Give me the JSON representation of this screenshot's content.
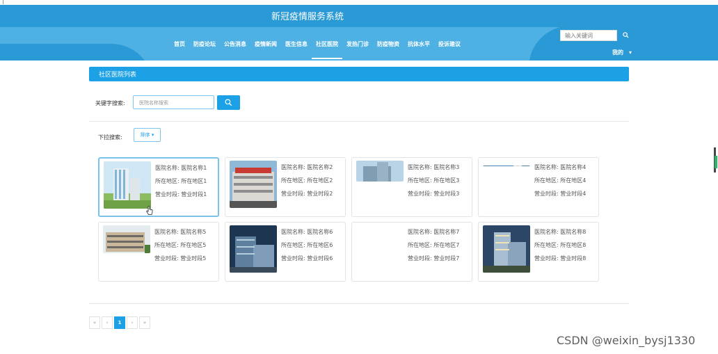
{
  "header": {
    "site_title": "新冠疫情服务系统",
    "nav": [
      {
        "label": "首页"
      },
      {
        "label": "防疫论坛"
      },
      {
        "label": "公告消息"
      },
      {
        "label": "疫情新闻"
      },
      {
        "label": "医生信息"
      },
      {
        "label": "社区医院",
        "active": true
      },
      {
        "label": "发热门诊"
      },
      {
        "label": "防疫物资"
      },
      {
        "label": "抗体水平"
      },
      {
        "label": "投诉建议"
      }
    ],
    "search_placeholder": "输入关键词",
    "user_label": "我的",
    "colors": {
      "primary": "#2a9ad6",
      "band": "#4fb1e3"
    }
  },
  "list": {
    "title": "社区医院列表",
    "keyword_label": "关键字搜索:",
    "keyword_placeholder": "医院名称搜索",
    "dropdown_label": "下拉搜索:",
    "sort_label": "排序",
    "field_labels": {
      "name": "医院名称:",
      "region": "所在地区:",
      "hours": "营业时段:"
    },
    "cards": [
      {
        "name": "医院名称1",
        "region": "所在地区1",
        "hours": "营业时段1",
        "hovered": true
      },
      {
        "name": "医院名称2",
        "region": "所在地区2",
        "hours": "营业时段2"
      },
      {
        "name": "医院名称3",
        "region": "所在地区3",
        "hours": "营业时段3"
      },
      {
        "name": "医院名称4",
        "region": "所在地区4",
        "hours": "营业时段4"
      },
      {
        "name": "医院名称5",
        "region": "所在地区5",
        "hours": "营业时段5"
      },
      {
        "name": "医院名称6",
        "region": "所在地区6",
        "hours": "营业时段6"
      },
      {
        "name": "医院名称7",
        "region": "所在地区7",
        "hours": "营业时段7"
      },
      {
        "name": "医院名称8",
        "region": "所在地区8",
        "hours": "营业时段8"
      }
    ],
    "accent": "#1da1e6"
  },
  "pager": {
    "first": "«",
    "prev": "‹",
    "current": "1",
    "next": "›",
    "last": "»"
  },
  "watermark": "CSDN @weixin_bysj1330"
}
